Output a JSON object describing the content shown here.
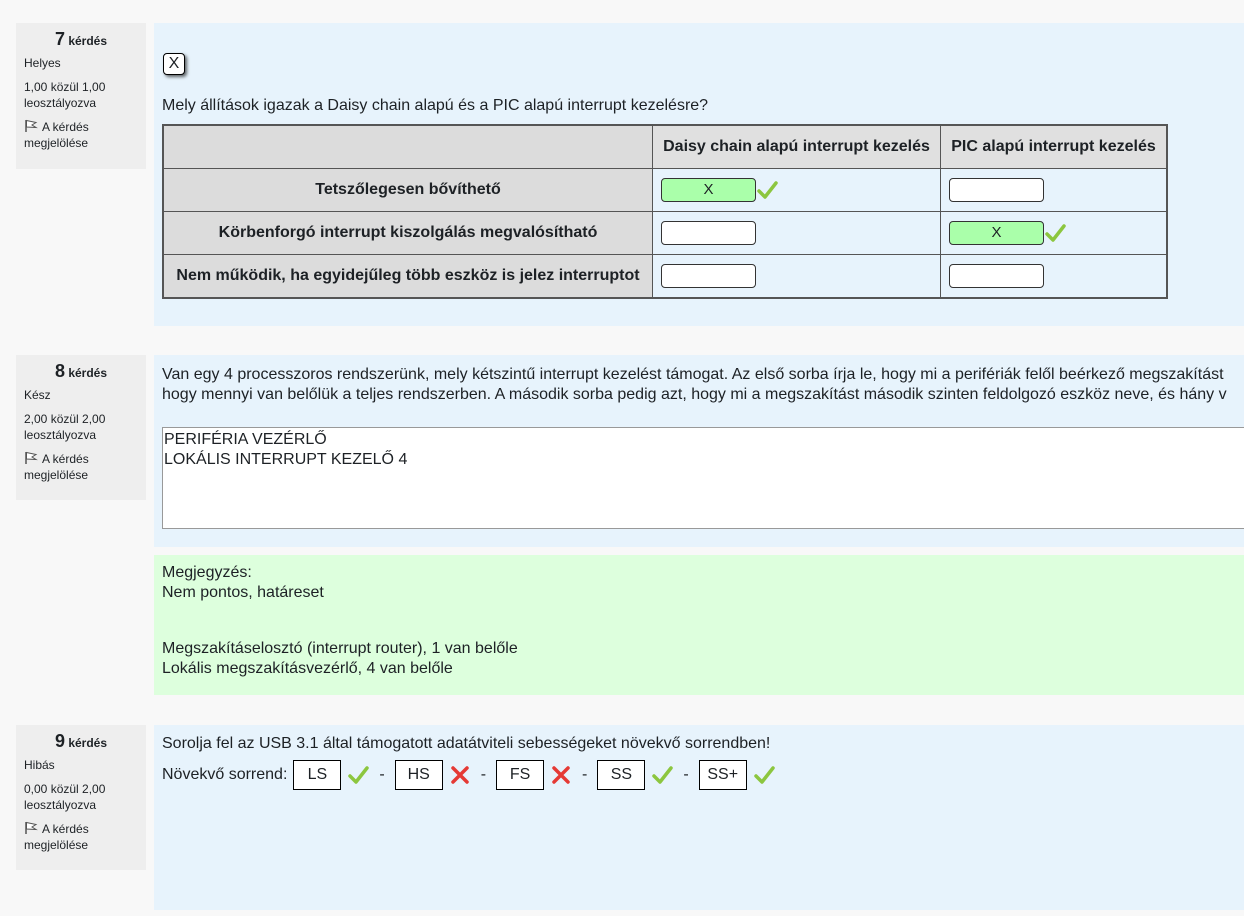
{
  "questions": [
    {
      "number": "7",
      "word": "kérdés",
      "state": "Helyes",
      "grade": "1,00 közül 1,00 leosztályozva",
      "flag": "A kérdés megjelölése",
      "close_label": "X",
      "text": "Mely állítások igazak a Daisy chain alapú és a PIC alapú interrupt kezelésre?",
      "columns": [
        "Daisy chain alapú interrupt kezelés",
        "PIC alapú interrupt kezelés"
      ],
      "rows": [
        {
          "label": "Tetszőlegesen bővíthető",
          "a": "X",
          "b": "",
          "a_correct": true,
          "b_correct": false
        },
        {
          "label": "Körbenforgó interrupt kiszolgálás megvalósítható",
          "a": "",
          "b": "X",
          "a_correct": false,
          "b_correct": true
        },
        {
          "label": "Nem működik, ha egyidejűleg több eszköz is jelez interruptot",
          "a": "",
          "b": "",
          "a_correct": false,
          "b_correct": false
        }
      ]
    },
    {
      "number": "8",
      "word": "kérdés",
      "state": "Kész",
      "grade": "2,00 közül 2,00 leosztályozva",
      "flag": "A kérdés megjelölése",
      "text_line1": "Van egy 4 processzoros rendszerünk, mely kétszintű interrupt kezelést támogat. Az első sorba írja le, hogy mi a perifériák felől beérkező megszakítást",
      "text_line2": "hogy mennyi van belőlük a teljes rendszerben. A második sorba pedig azt, hogy mi a megszakítást második szinten feldolgozó eszköz neve, és hány v",
      "answer": "PERIFÉRIA VEZÉRLŐ\nLOKÁLIS INTERRUPT KEZELŐ 4",
      "feedback_title": "Megjegyzés:",
      "feedback_line1": "Nem pontos, határeset",
      "feedback_line2": "Megszakításelosztó (interrupt router), 1 van belőle",
      "feedback_line3": "Lokális megszakításvezérlő, 4 van belőle"
    },
    {
      "number": "9",
      "word": "kérdés",
      "state": "Hibás",
      "grade": "0,00 közül 2,00 leosztályozva",
      "flag": "A kérdés megjelölése",
      "text": "Sorolja fel az USB 3.1 által támogatott adatátviteli sebességeket növekvő sorrendben!",
      "order_label": "Növekvő sorrend:",
      "separator": "-",
      "items": [
        {
          "value": "LS",
          "correct": true
        },
        {
          "value": "HS",
          "correct": false
        },
        {
          "value": "FS",
          "correct": false
        },
        {
          "value": "SS",
          "correct": true
        },
        {
          "value": "SS+",
          "correct": true
        }
      ]
    }
  ],
  "colors": {
    "correct": "#8cc63f",
    "wrong": "#e53935",
    "selected_bg": "#aaffaa",
    "content_bg": "#e7f3fc",
    "feedback_bg": "#ddffdd"
  }
}
